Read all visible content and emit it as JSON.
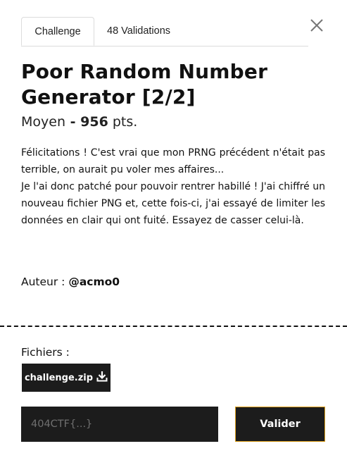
{
  "tabs": {
    "challenge": "Challenge",
    "validations": "48 Validations"
  },
  "close_icon": "close-icon",
  "title": "Poor Random Number Generator [2/2]",
  "difficulty": "Moyen",
  "separator": " - ",
  "points": "956",
  "points_unit": " pts.",
  "description": [
    "Félicitations ! C'est vrai que mon PRNG précédent n'était pas terrible, on aurait pu voler mes affaires...",
    "Je l'ai donc patché pour pouvoir rentrer habillé ! J'ai chiffré un nouveau fichier PNG et, cette fois-ci, j'ai essayé de limiter les données en clair qui ont fuité. Essayez de casser celui-là."
  ],
  "author_label": "Auteur : ",
  "author": "@acmo0",
  "files_label": "Fichiers :",
  "file": {
    "name": "challenge.zip",
    "icon": "download-icon"
  },
  "flag_input": {
    "placeholder": "404CTF{...}",
    "value": ""
  },
  "submit_label": "Valider",
  "colors": {
    "dark_button": "#1c1c1c",
    "accent_border": "#e0a21c"
  }
}
